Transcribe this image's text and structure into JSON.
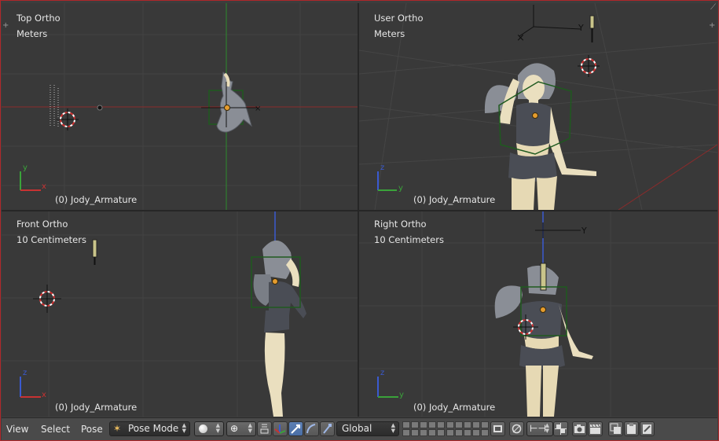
{
  "viewports": [
    {
      "view": "Top Ortho",
      "scale": "Meters",
      "object": "(0) Jody_Armature",
      "axes": [
        "y",
        "x"
      ]
    },
    {
      "view": "User Ortho",
      "scale": "Meters",
      "object": "(0) Jody_Armature",
      "axes": [
        "z",
        "y"
      ]
    },
    {
      "view": "Front Ortho",
      "scale": "10 Centimeters",
      "object": "(0) Jody_Armature",
      "axes": [
        "z",
        "x"
      ]
    },
    {
      "view": "Right Ortho",
      "scale": "10 Centimeters",
      "object": "(0) Jody_Armature",
      "axes": [
        "z",
        "y"
      ]
    }
  ],
  "gizmo_labels": {
    "user_y": "Y",
    "right_y": "Y"
  },
  "header": {
    "menu_view": "View",
    "menu_select": "Select",
    "menu_pose": "Pose",
    "mode": "Pose Mode",
    "orientation": "Global"
  },
  "colors": {
    "frame_border": "#b0272a",
    "viewport_bg": "#393939",
    "header_bg": "#4a4a4a",
    "active_button": "#5d80b4",
    "axis_x": "#c83232",
    "axis_y": "#3aa33a",
    "axis_z": "#3a5ad0"
  },
  "icons": [
    "object-mode-icon",
    "shading-solid-icon",
    "pivot-icon",
    "manipulator-icon",
    "translate-icon",
    "rotate-icon",
    "scale-icon",
    "render-icon",
    "snap-icon",
    "proportional-icon",
    "camera-icon",
    "clapper-icon",
    "copy-pose-icon",
    "paste-pose-icon",
    "paste-flipped-icon"
  ]
}
